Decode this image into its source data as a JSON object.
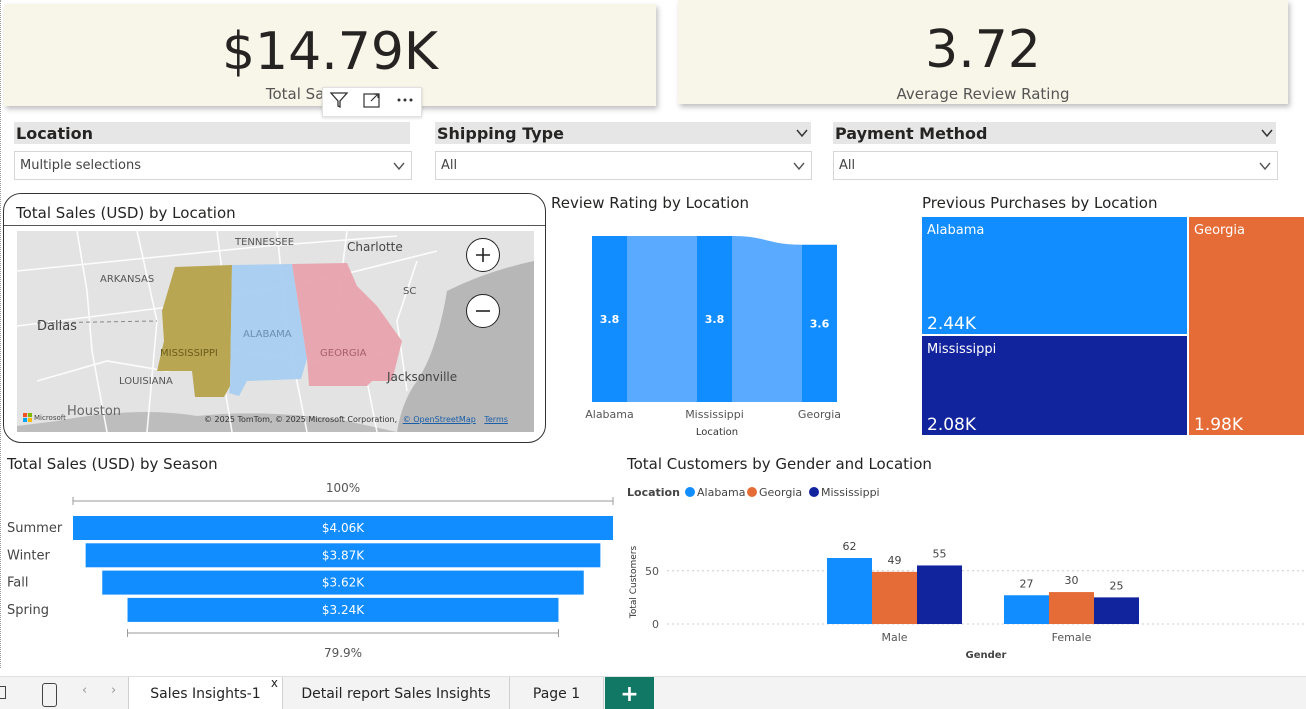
{
  "kpis": {
    "total_sales": {
      "value": "$14.79K",
      "label": "Total Sales (USD)"
    },
    "avg_rating": {
      "value": "3.72",
      "label": "Average Review Rating"
    }
  },
  "slicers": {
    "location": {
      "title": "Location",
      "value": "Multiple selections"
    },
    "shipping": {
      "title": "Shipping Type",
      "value": "All"
    },
    "payment": {
      "title": "Payment Method",
      "value": "All"
    }
  },
  "map": {
    "title": "Total Sales (USD) by Location",
    "labels": {
      "tennessee": "TENNESSEE",
      "charlotte": "Charlotte",
      "arkansas": "ARKANSAS",
      "sc": "SC",
      "dallas": "Dallas",
      "alabama": "ALABAMA",
      "mississippi": "MISSISSIPPI",
      "georgia": "GEORGIA",
      "louisiana": "LOUISIANA",
      "jacksonville": "Jacksonville",
      "houston": "Houston"
    },
    "attribution": "© 2025 TomTom, © 2025 Microsoft Corporation,",
    "osm": "© OpenStreetMap",
    "terms": "Terms",
    "ms_logo": "Microsoft",
    "colors": {
      "mississippi": "#b5a24a",
      "alabama": "#a8cdf0",
      "georgia": "#e8a3ad"
    }
  },
  "review_chart": {
    "title": "Review Rating by Location",
    "xlabel": "Location"
  },
  "treemap": {
    "title": "Previous Purchases by Location"
  },
  "season_chart": {
    "title": "Total Sales (USD) by Season",
    "top_pct": "100%",
    "bottom_pct": "79.9%"
  },
  "gender_chart": {
    "title": "Total Customers by Gender and Location",
    "legend_title": "Location",
    "xlabel": "Gender",
    "ylabel": "Total Customers"
  },
  "chart_data": [
    {
      "type": "bar",
      "title": "Review Rating by Location",
      "categories": [
        "Alabama",
        "Mississippi",
        "Georgia"
      ],
      "values": [
        3.8,
        3.8,
        3.6
      ],
      "data_labels": [
        "3.8",
        "3.8",
        "3.6"
      ],
      "xlabel": "Location",
      "color": "#118dff"
    },
    {
      "type": "heatmap",
      "title": "Previous Purchases by Location",
      "categories": [
        "Alabama",
        "Mississippi",
        "Georgia"
      ],
      "values": [
        2440,
        2080,
        1980
      ],
      "data_labels": [
        "2.44K",
        "2.08K",
        "1.98K"
      ],
      "colors": [
        "#118dff",
        "#12239e",
        "#e66c37"
      ]
    },
    {
      "type": "bar",
      "title": "Total Sales (USD) by Season",
      "categories": [
        "Summer",
        "Winter",
        "Fall",
        "Spring"
      ],
      "values": [
        4060,
        3870,
        3620,
        3240
      ],
      "data_labels": [
        "$4.06K",
        "$3.87K",
        "$3.62K",
        "$3.24K"
      ],
      "color": "#118dff"
    },
    {
      "type": "bar",
      "title": "Total Customers by Gender and Location",
      "categories": [
        "Male",
        "Female"
      ],
      "series": [
        {
          "name": "Alabama",
          "values": [
            62,
            27
          ],
          "color": "#118dff"
        },
        {
          "name": "Georgia",
          "values": [
            49,
            30
          ],
          "color": "#e66c37"
        },
        {
          "name": "Mississippi",
          "values": [
            55,
            25
          ],
          "color": "#12239e"
        }
      ],
      "xlabel": "Gender",
      "ylabel": "Total Customers",
      "yticks": [
        "0",
        "50"
      ],
      "ylim": [
        0,
        75
      ]
    }
  ],
  "tabs": {
    "items": [
      "Sales Insights-1",
      "Detail report Sales Insights",
      "Page 1"
    ],
    "close": "x",
    "add": "+"
  }
}
